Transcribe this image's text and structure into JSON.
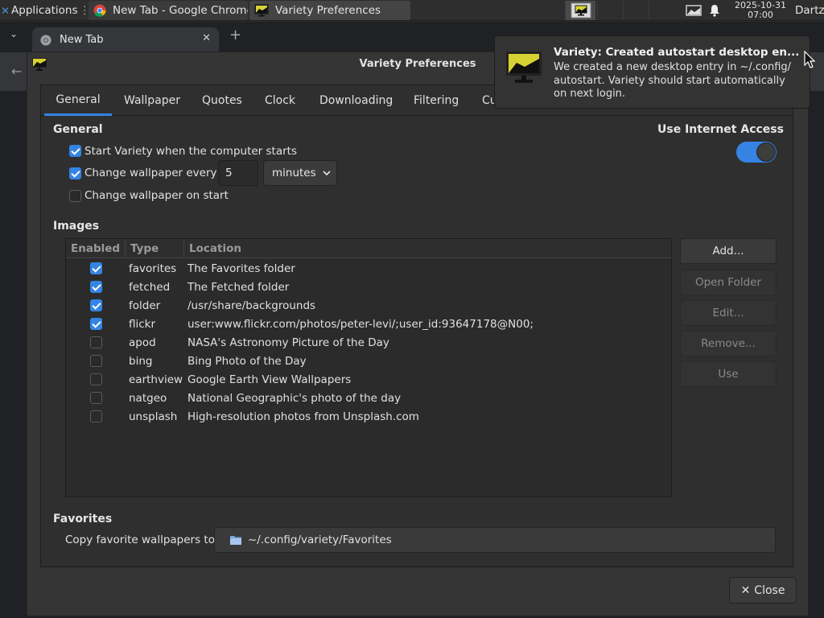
{
  "panel": {
    "applications_label": "Applications",
    "tasks": [
      {
        "label": "New Tab - Google Chrome",
        "icon": "chrome-icon"
      },
      {
        "label": "Variety Preferences",
        "icon": "variety-icon"
      }
    ],
    "clock_date": "2025-10-31",
    "clock_time": "07:00",
    "user": "Dartz"
  },
  "chrome": {
    "tab_title": "New Tab"
  },
  "dialog": {
    "title": "Variety Preferences",
    "tabs": [
      "General",
      "Wallpaper",
      "Quotes",
      "Clock",
      "Downloading",
      "Filtering",
      "Cu"
    ],
    "active_tab": "General",
    "general": {
      "section_title": "General",
      "start_on_boot": {
        "label": "Start Variety when the computer starts",
        "checked": true
      },
      "change_every": {
        "label": "Change wallpaper every",
        "checked": true,
        "value": "5",
        "unit": "minutes"
      },
      "change_on_start": {
        "label": "Change wallpaper on start",
        "checked": false
      },
      "internet_access": {
        "label": "Use Internet Access",
        "enabled": true
      }
    },
    "images": {
      "section_title": "Images",
      "columns": [
        "Enabled",
        "Type",
        "Location"
      ],
      "rows": [
        {
          "enabled": true,
          "type": "favorites",
          "location": "The Favorites folder"
        },
        {
          "enabled": true,
          "type": "fetched",
          "location": "The Fetched folder"
        },
        {
          "enabled": true,
          "type": "folder",
          "location": "/usr/share/backgrounds"
        },
        {
          "enabled": true,
          "type": "flickr",
          "location": "user:www.flickr.com/photos/peter-levi/;user_id:93647178@N00;"
        },
        {
          "enabled": false,
          "type": "apod",
          "location": "NASA's Astronomy Picture of the Day"
        },
        {
          "enabled": false,
          "type": "bing",
          "location": "Bing Photo of the Day"
        },
        {
          "enabled": false,
          "type": "earthview",
          "location": "Google Earth View Wallpapers"
        },
        {
          "enabled": false,
          "type": "natgeo",
          "location": "National Geographic's photo of the day"
        },
        {
          "enabled": false,
          "type": "unsplash",
          "location": "High-resolution photos from Unsplash.com"
        }
      ],
      "buttons": {
        "add": "Add...",
        "open_folder": "Open Folder",
        "edit": "Edit...",
        "remove": "Remove...",
        "use": "Use"
      }
    },
    "favorites": {
      "section_title": "Favorites",
      "copy_label": "Copy favorite wallpapers to",
      "path": "~/.config/variety/Favorites"
    },
    "close_label": "Close"
  },
  "notification": {
    "title": "Variety: Created autostart desktop en...",
    "body": "We created a new desktop entry in ~/.config/ autostart. Variety should start automatically on next login."
  },
  "colors": {
    "accent": "#3584e4",
    "panel_bg": "#2e2e2e",
    "dialog_bg": "#353535"
  }
}
